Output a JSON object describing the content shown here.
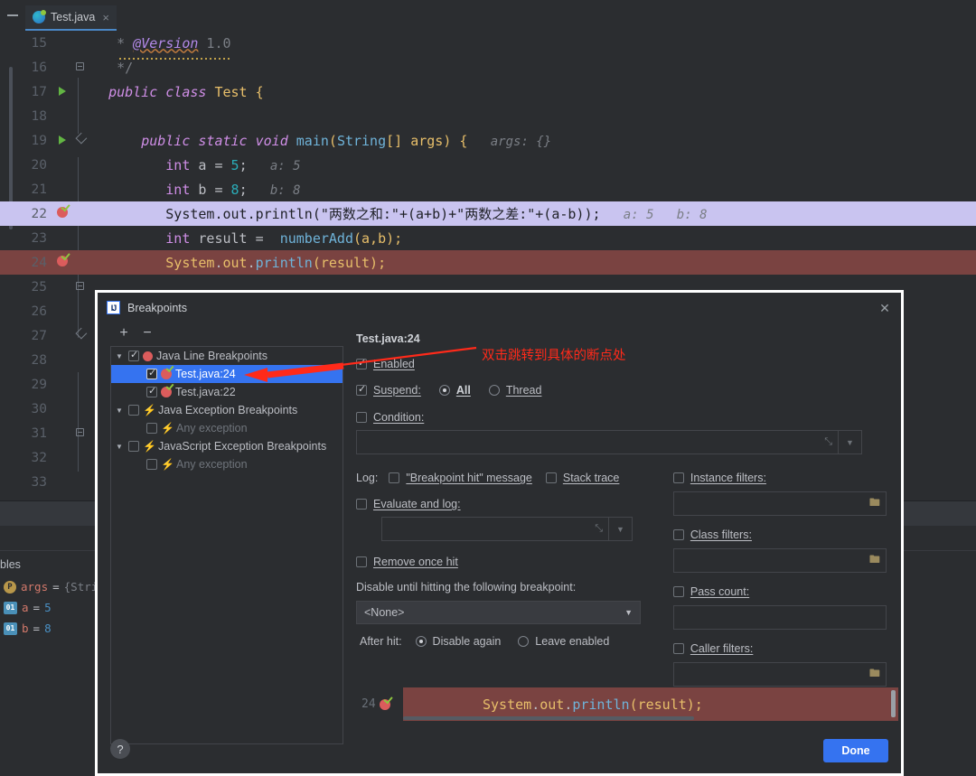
{
  "ide": {
    "collapse_icon": "collapse-icon",
    "tab": {
      "label": "Test.java",
      "close": "×",
      "icon": "java-class-icon"
    }
  },
  "editor": {
    "lines": [
      {
        "num": "15",
        "gutter": "",
        "fold": "",
        "segments": [
          {
            "t": "   * ",
            "c": "doc"
          },
          {
            "t": "@Version",
            "c": "anno"
          },
          {
            "t": " 1.0",
            "c": "doc"
          }
        ]
      },
      {
        "num": "16",
        "gutter": "",
        "fold": "fold-box",
        "segments": [
          {
            "t": "   */",
            "c": "doc"
          }
        ]
      },
      {
        "num": "17",
        "gutter": "run",
        "fold": "",
        "segments": [
          {
            "t": "  ",
            "c": "pnc"
          },
          {
            "t": "public class",
            "c": "kw"
          },
          {
            "t": " ",
            "c": "pnc"
          },
          {
            "t": "Test",
            "c": "cls"
          },
          {
            "t": " {",
            "c": "typ"
          }
        ]
      },
      {
        "num": "18",
        "gutter": "",
        "fold": "",
        "segments": []
      },
      {
        "num": "19",
        "gutter": "run",
        "fold": "fold-end",
        "segments": [
          {
            "t": "      ",
            "c": "pnc"
          },
          {
            "t": "public static void",
            "c": "kw"
          },
          {
            "t": " ",
            "c": "pnc"
          },
          {
            "t": "main",
            "c": "meth"
          },
          {
            "t": "(",
            "c": "typ"
          },
          {
            "t": "String",
            "c": "meth"
          },
          {
            "t": "[] args",
            "c": "typ"
          },
          {
            "t": ") {",
            "c": "typ"
          },
          {
            "t": "   args: {}",
            "c": "hint"
          }
        ]
      },
      {
        "num": "20",
        "gutter": "",
        "fold": "",
        "segments": [
          {
            "t": "         ",
            "c": "pnc"
          },
          {
            "t": "int",
            "c": "kwb"
          },
          {
            "t": " a = ",
            "c": "pnc"
          },
          {
            "t": "5",
            "c": "num"
          },
          {
            "t": ";",
            "c": "pnc"
          },
          {
            "t": "   a: 5",
            "c": "hint"
          }
        ]
      },
      {
        "num": "21",
        "gutter": "",
        "fold": "",
        "segments": [
          {
            "t": "         ",
            "c": "pnc"
          },
          {
            "t": "int",
            "c": "kwb"
          },
          {
            "t": " b = ",
            "c": "pnc"
          },
          {
            "t": "8",
            "c": "num"
          },
          {
            "t": ";",
            "c": "pnc"
          },
          {
            "t": "   b: 8",
            "c": "hint"
          }
        ]
      },
      {
        "num": "22",
        "gutter": "bp",
        "fold": "",
        "style": "hl-current",
        "segments": [
          {
            "t": "         System.out.println(\"两数之和:\"+(a+b)+\"两数之差:\"+(a-b));",
            "c": ""
          },
          {
            "t": "   a: 5   b: 8",
            "c": "hint"
          }
        ]
      },
      {
        "num": "23",
        "gutter": "",
        "fold": "",
        "segments": [
          {
            "t": "         ",
            "c": "pnc"
          },
          {
            "t": "int",
            "c": "kwb"
          },
          {
            "t": " result =  ",
            "c": "pnc"
          },
          {
            "t": "numberAdd",
            "c": "meth"
          },
          {
            "t": "(a,b);",
            "c": "typ"
          }
        ]
      },
      {
        "num": "24",
        "gutter": "bp",
        "fold": "",
        "style": "hl-bp",
        "segments": [
          {
            "t": "         ",
            "c": ""
          },
          {
            "t": "System",
            "c": "typ"
          },
          {
            "t": ".",
            "c": "pnc"
          },
          {
            "t": "out",
            "c": "typ"
          },
          {
            "t": ".",
            "c": "pnc"
          },
          {
            "t": "println",
            "c": "meth"
          },
          {
            "t": "(result);",
            "c": "typ"
          }
        ]
      },
      {
        "num": "25",
        "gutter": "",
        "fold": "fold-box",
        "segments": []
      },
      {
        "num": "26",
        "gutter": "",
        "fold": "",
        "segments": []
      },
      {
        "num": "27",
        "gutter": "",
        "fold": "fold-end",
        "segments": []
      },
      {
        "num": "28",
        "gutter": "",
        "fold": "",
        "segments": []
      },
      {
        "num": "29",
        "gutter": "",
        "fold": "",
        "segments": []
      },
      {
        "num": "30",
        "gutter": "",
        "fold": "",
        "segments": []
      },
      {
        "num": "31",
        "gutter": "",
        "fold": "fold-box",
        "segments": []
      },
      {
        "num": "32",
        "gutter": "",
        "fold": "",
        "segments": []
      },
      {
        "num": "33",
        "gutter": "",
        "fold": "",
        "segments": []
      }
    ]
  },
  "debug": {
    "variables_tab": "bles",
    "variables": [
      {
        "icon": "p",
        "icon_text": "P",
        "name": "args",
        "eq": "=",
        "value": "{String"
      },
      {
        "icon": "01",
        "icon_text": "01",
        "name": "a",
        "eq": "=",
        "value": "5"
      },
      {
        "icon": "01",
        "icon_text": "01",
        "name": "b",
        "eq": "=",
        "value": "8"
      }
    ]
  },
  "dialog": {
    "title": "Breakpoints",
    "close_label": "✕",
    "toolbar": {
      "add": "+",
      "remove": "−"
    },
    "tree": [
      {
        "indent": 0,
        "arrow": "▼",
        "checked": true,
        "icon": "circle",
        "label": "Java Line Breakpoints",
        "selected": false,
        "muted": false
      },
      {
        "indent": 1,
        "arrow": "",
        "checked": true,
        "icon": "bpcheck",
        "label": "Test.java:24",
        "selected": true,
        "muted": false
      },
      {
        "indent": 1,
        "arrow": "",
        "checked": true,
        "icon": "bpcheck",
        "label": "Test.java:22",
        "selected": false,
        "muted": false
      },
      {
        "indent": 0,
        "arrow": "▼",
        "checked": false,
        "icon": "bolt",
        "label": "Java Exception Breakpoints",
        "selected": false,
        "muted": false
      },
      {
        "indent": 1,
        "arrow": "",
        "checked": false,
        "icon": "bolt",
        "label": "Any exception",
        "selected": false,
        "muted": true
      },
      {
        "indent": 0,
        "arrow": "▼",
        "checked": false,
        "icon": "bolt",
        "label": "JavaScript Exception Breakpoints",
        "selected": false,
        "muted": false
      },
      {
        "indent": 1,
        "arrow": "",
        "checked": false,
        "icon": "bolt",
        "label": "Any exception",
        "selected": false,
        "muted": true
      }
    ],
    "detail": {
      "title": "Test.java:24",
      "enabled_label": "Enabled",
      "enabled_checked": true,
      "suspend_label": "Suspend:",
      "suspend_checked": true,
      "suspend_all": "All",
      "suspend_thread": "Thread",
      "suspend_selected": "All",
      "condition_label": "Condition:",
      "condition_checked": false,
      "condition_value": "",
      "log_label": "Log:",
      "log_message_label": "\"Breakpoint hit\" message",
      "log_message_checked": false,
      "stack_trace_label": "Stack trace",
      "stack_trace_checked": false,
      "evaluate_label": "Evaluate and log:",
      "evaluate_checked": false,
      "evaluate_value": "",
      "remove_once_hit_label": "Remove once hit",
      "remove_once_hit_checked": false,
      "disable_until_label": "Disable until hitting the following breakpoint:",
      "disable_until_value": "<None>",
      "after_hit_label": "After hit:",
      "after_hit_disable": "Disable again",
      "after_hit_leave": "Leave enabled",
      "after_hit_selected": "Disable again",
      "instance_filters_label": "Instance filters:",
      "instance_filters_checked": false,
      "instance_filters_value": "",
      "class_filters_label": "Class filters:",
      "class_filters_checked": false,
      "class_filters_value": "",
      "pass_count_label": "Pass count:",
      "pass_count_checked": false,
      "pass_count_value": "",
      "caller_filters_label": "Caller filters:",
      "caller_filters_checked": false,
      "caller_filters_value": ""
    },
    "preview": {
      "line_number": "24",
      "code": "System.out.println(result);"
    },
    "help_label": "?",
    "done_label": "Done"
  },
  "annotation": {
    "text": "双击跳转到具体的断点处",
    "color": "#ff2a1a"
  },
  "colors": {
    "accent": "#3573f0",
    "breakpoint": "#db5c5c",
    "current_line": "#c9c4f0",
    "bp_line": "#7a4341",
    "background": "#2b2d30"
  }
}
